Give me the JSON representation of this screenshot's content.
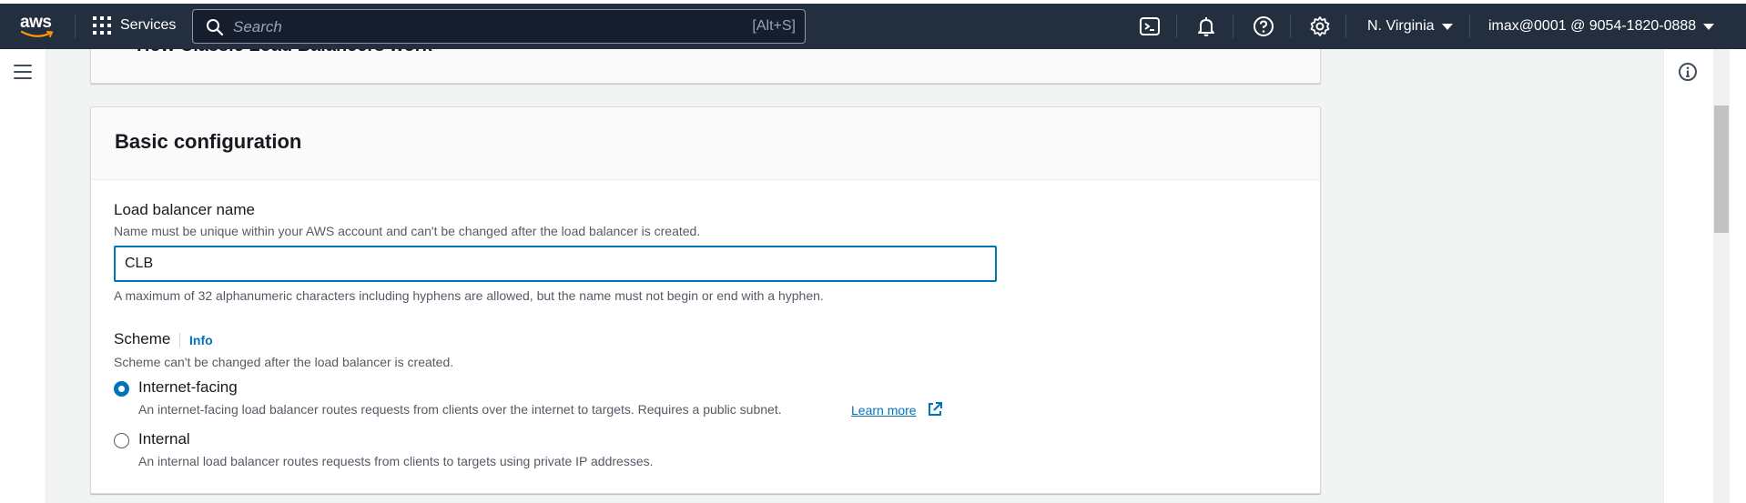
{
  "topnav": {
    "logo_text": "aws",
    "services_label": "Services",
    "search_placeholder": "Search",
    "search_shortcut": "[Alt+S]",
    "region": "N. Virginia",
    "account": "imax@0001 @ 9054-1820-0888",
    "icons": [
      "cloudshell-icon",
      "bell-icon",
      "help-icon",
      "gear-icon"
    ],
    "background_color": "#232f3e"
  },
  "collapsed_panel": {
    "title": "How Classic Load Balancers work"
  },
  "basic_config": {
    "title": "Basic configuration",
    "name_field": {
      "label": "Load balancer name",
      "description": "Name must be unique within your AWS account and can't be changed after the load balancer is created.",
      "value": "CLB",
      "constraint": "A maximum of 32 alphanumeric characters including hyphens are allowed, but the name must not begin or end with a hyphen."
    },
    "scheme": {
      "label": "Scheme",
      "info_link": "Info",
      "description": "Scheme can't be changed after the load balancer is created.",
      "options": [
        {
          "label": "Internet-facing",
          "description": "An internet-facing load balancer routes requests from clients over the internet to targets. Requires a public subnet.",
          "learn_more": "Learn more",
          "selected": true
        },
        {
          "label": "Internal",
          "description": "An internal load balancer routes requests from clients to targets using private IP addresses.",
          "selected": false
        }
      ]
    }
  },
  "colors": {
    "accent": "#0073bb",
    "page_background": "#f2f3f3"
  }
}
